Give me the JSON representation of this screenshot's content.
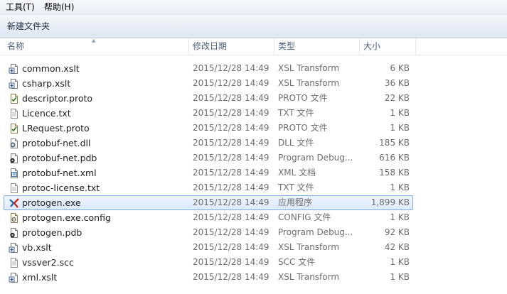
{
  "menubar": {
    "tools": "工具(T)",
    "help": "帮助(H)"
  },
  "toolbar": {
    "new_folder": "新建文件夹"
  },
  "columns": {
    "name": "名称",
    "date": "修改日期",
    "type": "类型",
    "size": "大小"
  },
  "files": [
    {
      "name": "common.xslt",
      "date": "2015/12/28 14:49",
      "type": "XSL Transform",
      "size": "6 KB",
      "icon": "xslt-file-icon"
    },
    {
      "name": "csharp.xslt",
      "date": "2015/12/28 14:49",
      "type": "XSL Transform",
      "size": "36 KB",
      "icon": "xslt-file-icon"
    },
    {
      "name": "descriptor.proto",
      "date": "2015/12/28 14:49",
      "type": "PROTO 文件",
      "size": "22 KB",
      "icon": "proto-file-icon"
    },
    {
      "name": "Licence.txt",
      "date": "2015/12/28 14:49",
      "type": "TXT 文件",
      "size": "1 KB",
      "icon": "text-file-icon"
    },
    {
      "name": "LRequest.proto",
      "date": "2015/12/28 14:49",
      "type": "PROTO 文件",
      "size": "1 KB",
      "icon": "proto-file-icon"
    },
    {
      "name": "protobuf-net.dll",
      "date": "2015/12/28 14:49",
      "type": "DLL 文件",
      "size": "185 KB",
      "icon": "dll-file-icon"
    },
    {
      "name": "protobuf-net.pdb",
      "date": "2015/12/28 14:49",
      "type": "Program Debug...",
      "size": "616 KB",
      "icon": "pdb-file-icon"
    },
    {
      "name": "protobuf-net.xml",
      "date": "2015/12/28 14:49",
      "type": "XML 文档",
      "size": "158 KB",
      "icon": "xml-file-icon"
    },
    {
      "name": "protoc-license.txt",
      "date": "2015/12/28 14:49",
      "type": "TXT 文件",
      "size": "1 KB",
      "icon": "text-file-icon"
    },
    {
      "name": "protogen.exe",
      "date": "2015/12/28 14:49",
      "type": "应用程序",
      "size": "1,899 KB",
      "icon": "exe-file-icon",
      "selected": true
    },
    {
      "name": "protogen.exe.config",
      "date": "2015/12/28 14:49",
      "type": "CONFIG 文件",
      "size": "1 KB",
      "icon": "config-file-icon"
    },
    {
      "name": "protogen.pdb",
      "date": "2015/12/28 14:49",
      "type": "Program Debug...",
      "size": "92 KB",
      "icon": "pdb-file-icon"
    },
    {
      "name": "vb.xslt",
      "date": "2015/12/28 14:49",
      "type": "XSL Transform",
      "size": "42 KB",
      "icon": "xslt-file-icon"
    },
    {
      "name": "vssver2.scc",
      "date": "2015/12/28 14:49",
      "type": "SCC 文件",
      "size": "1 KB",
      "icon": "text-file-icon"
    },
    {
      "name": "xml.xslt",
      "date": "2015/12/28 14:49",
      "type": "XSL Transform",
      "size": "1 KB",
      "icon": "xslt-file-icon"
    }
  ],
  "colors": {
    "selection_border": "#84acdd",
    "selection_fill": "#dceafc",
    "header_text": "#4c607a",
    "detail_text": "#6d6d6d"
  }
}
